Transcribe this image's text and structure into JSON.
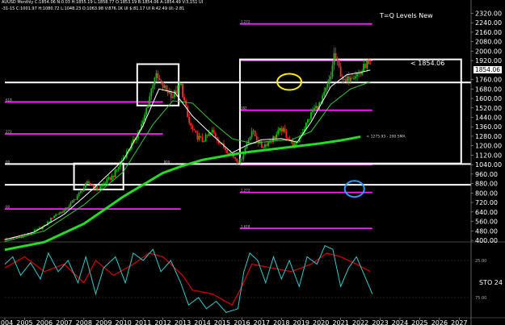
{
  "header": {
    "line1": "AUUSD Monthly C:1854.06 N:0.03 H:1855.19 L:1858.77 O:1853.19 B:1854.06 A:1854.49 V:3,151 UI",
    "line2": "-31-15 C:1001.97 H:1080.72 L:1048.23 O:1063.98 V:876.1K UI $:81.17 UI R:42.49 UI:-2.81"
  },
  "levels_title": "T=Q Levels New",
  "current_price_label": "< 1854.06",
  "price_tag": "1854.06",
  "sma_label": "< 1275.93 - 200 SMA",
  "sto_label": "STO 24",
  "colors": {
    "up": "#00c800",
    "down": "#ff2a2a",
    "sma_fast": "#ffffff",
    "sma_mid": "#33cc33",
    "sma_200": "#22dd22",
    "magenta": "#ff22ff",
    "red_line": "#cc0000",
    "cyan": "#33cccc",
    "yellow_circle": "#ffee00",
    "blue_circle": "#3399ff"
  },
  "chart_data": [
    {
      "type": "candlestick",
      "title": "AUUSD Monthly",
      "y_ticks": [
        400,
        480,
        560,
        640,
        720,
        800,
        880,
        960,
        1040,
        1120,
        1200,
        1280,
        1360,
        1440,
        1520,
        1600,
        1680,
        1760,
        1840,
        1920,
        2000,
        2080,
        2160,
        2240,
        2320
      ],
      "x_ticks": [
        "2004",
        "2005",
        "2006",
        "2007",
        "2008",
        "2009",
        "2010",
        "2011",
        "2012",
        "2013",
        "2014",
        "2015",
        "2016",
        "2017",
        "2018",
        "2019",
        "2020",
        "2021",
        "2022",
        "2023",
        "2024",
        "2025",
        "2026",
        "2027"
      ],
      "ylim": [
        400,
        2330
      ],
      "xlim": [
        2004.0,
        2027.6
      ],
      "grid": false,
      "close_anchors": [
        [
          2004.0,
          410
        ],
        [
          2005.0,
          435
        ],
        [
          2006.0,
          520
        ],
        [
          2006.5,
          610
        ],
        [
          2007.0,
          650
        ],
        [
          2007.6,
          760
        ],
        [
          2008.2,
          890
        ],
        [
          2008.7,
          830
        ],
        [
          2009.0,
          880
        ],
        [
          2009.5,
          950
        ],
        [
          2010.0,
          1100
        ],
        [
          2010.5,
          1230
        ],
        [
          2011.0,
          1400
        ],
        [
          2011.6,
          1800
        ],
        [
          2012.0,
          1700
        ],
        [
          2012.5,
          1620
        ],
        [
          2012.9,
          1720
        ],
        [
          2013.3,
          1400
        ],
        [
          2013.6,
          1300
        ],
        [
          2014.0,
          1240
        ],
        [
          2014.5,
          1320
        ],
        [
          2015.0,
          1200
        ],
        [
          2015.9,
          1060
        ],
        [
          2016.5,
          1330
        ],
        [
          2017.0,
          1190
        ],
        [
          2017.5,
          1250
        ],
        [
          2018.0,
          1340
        ],
        [
          2018.7,
          1190
        ],
        [
          2019.0,
          1300
        ],
        [
          2019.6,
          1500
        ],
        [
          2020.0,
          1560
        ],
        [
          2020.5,
          1780
        ],
        [
          2020.65,
          1980
        ],
        [
          2021.2,
          1720
        ],
        [
          2021.5,
          1800
        ],
        [
          2022.0,
          1810
        ],
        [
          2022.3,
          1900
        ],
        [
          2022.5,
          1854
        ]
      ],
      "series": [
        {
          "name": "200 SMA",
          "anchors": [
            [
              2004.0,
              320
            ],
            [
              2006.0,
              385
            ],
            [
              2008.0,
              540
            ],
            [
              2010.0,
              770
            ],
            [
              2012.0,
              970
            ],
            [
              2013.0,
              1030
            ],
            [
              2014.0,
              1080
            ],
            [
              2015.0,
              1110
            ],
            [
              2016.0,
              1140
            ],
            [
              2017.0,
              1160
            ],
            [
              2018.0,
              1180
            ],
            [
              2019.0,
              1200
            ],
            [
              2020.0,
              1220
            ],
            [
              2021.0,
              1245
            ],
            [
              2022.0,
              1276
            ]
          ],
          "value_label": 1275.93
        },
        {
          "name": "fast SMA",
          "anchors": [
            [
              2004.0,
              405
            ],
            [
              2005.5,
              470
            ],
            [
              2007.0,
              620
            ],
            [
              2008.5,
              840
            ],
            [
              2010.0,
              1080
            ],
            [
              2011.0,
              1370
            ],
            [
              2011.8,
              1680
            ],
            [
              2012.6,
              1650
            ],
            [
              2013.5,
              1450
            ],
            [
              2014.5,
              1290
            ],
            [
              2015.5,
              1140
            ],
            [
              2016.2,
              1200
            ],
            [
              2017.0,
              1250
            ],
            [
              2018.0,
              1260
            ],
            [
              2018.8,
              1230
            ],
            [
              2019.5,
              1400
            ],
            [
              2020.5,
              1700
            ],
            [
              2021.3,
              1800
            ],
            [
              2022.0,
              1820
            ],
            [
              2022.5,
              1840
            ]
          ]
        },
        {
          "name": "mid SMA",
          "anchors": [
            [
              2004.0,
              390
            ],
            [
              2006.0,
              480
            ],
            [
              2008.0,
              700
            ],
            [
              2010.0,
              980
            ],
            [
              2011.5,
              1380
            ],
            [
              2012.5,
              1580
            ],
            [
              2013.5,
              1560
            ],
            [
              2014.5,
              1400
            ],
            [
              2015.5,
              1260
            ],
            [
              2016.5,
              1220
            ],
            [
              2017.5,
              1240
            ],
            [
              2018.5,
              1250
            ],
            [
              2019.5,
              1320
            ],
            [
              2020.5,
              1550
            ],
            [
              2021.5,
              1680
            ],
            [
              2022.5,
              1740
            ]
          ]
        }
      ],
      "levels": [
        {
          "price": 1930,
          "label": "< 1854.06"
        },
        {
          "price": 1735
        },
        {
          "price": 1045
        },
        {
          "price": 870
        }
      ],
      "fib_levels": [
        {
          "label": "1.272",
          "price": 2230,
          "x_from": 2015.9,
          "x_to": 2022.6
        },
        {
          "label": "",
          "price": 1920,
          "x_from": 2015.9,
          "x_to": 2022.6
        },
        {
          "label": "618",
          "price": 1570,
          "x_from": 2004.0,
          "x_to": 2012.0
        },
        {
          "label": "382",
          "price": 1500,
          "x_from": 2015.9,
          "x_to": 2022.6
        },
        {
          "label": "272",
          "price": 1300,
          "x_from": 2004.0,
          "x_to": 2012.0
        },
        {
          "label": "00",
          "price": 1045,
          "x_from": 2004.0,
          "x_to": 2010.5
        },
        {
          "label": "800",
          "price": 1045,
          "x_from": 2012.0,
          "x_to": 2012.5
        },
        {
          "label": "",
          "price": 1040,
          "x_from": 2015.9,
          "x_to": 2022.6
        },
        {
          "label": "1.272",
          "price": 805,
          "x_from": 2015.9,
          "x_to": 2022.6
        },
        {
          "label": "00",
          "price": 665,
          "x_from": 2004.0,
          "x_to": 2012.9
        },
        {
          "label": "1.618",
          "price": 500,
          "x_from": 2015.9,
          "x_to": 2022.6
        }
      ],
      "boxes": [
        {
          "x0": 2007.5,
          "x1": 2010.0,
          "y0": 830,
          "y1": 1050
        },
        {
          "x0": 2010.7,
          "x1": 2012.8,
          "y0": 1540,
          "y1": 1890
        },
        {
          "x0": 2015.9,
          "x1": 2027.1,
          "y0": 1050,
          "y1": 1930
        }
      ]
    },
    {
      "type": "line",
      "title": "STO 24",
      "y_ticks": [
        25.0,
        75.0
      ],
      "ylim": [
        0,
        100
      ],
      "series": [
        {
          "name": "",
          "anchors": [
            [
              2004.0,
              35
            ],
            [
              2005.0,
              20
            ],
            [
              2006.0,
              40
            ],
            [
              2007.0,
              30
            ],
            [
              2008.0,
              55
            ],
            [
              2008.6,
              25
            ],
            [
              2009.5,
              45
            ],
            [
              2010.5,
              30
            ],
            [
              2011.3,
              15
            ],
            [
              2012.0,
              20
            ],
            [
              2013.0,
              45
            ],
            [
              2013.5,
              65
            ],
            [
              2014.5,
              70
            ],
            [
              2015.5,
              85
            ],
            [
              2016.0,
              60
            ],
            [
              2016.5,
              30
            ],
            [
              2017.5,
              35
            ],
            [
              2018.5,
              40
            ],
            [
              2019.5,
              30
            ],
            [
              2020.3,
              15
            ],
            [
              2021.0,
              20
            ],
            [
              2021.8,
              30
            ],
            [
              2022.5,
              40
            ]
          ]
        },
        {
          "name": "",
          "anchors": [
            [
              2004.0,
              30
            ],
            [
              2004.4,
              20
            ],
            [
              2004.8,
              45
            ],
            [
              2005.3,
              28
            ],
            [
              2005.8,
              50
            ],
            [
              2006.2,
              15
            ],
            [
              2006.7,
              40
            ],
            [
              2007.2,
              25
            ],
            [
              2007.7,
              55
            ],
            [
              2008.1,
              20
            ],
            [
              2008.6,
              70
            ],
            [
              2009.0,
              35
            ],
            [
              2009.6,
              20
            ],
            [
              2010.1,
              55
            ],
            [
              2010.5,
              15
            ],
            [
              2011.0,
              25
            ],
            [
              2011.5,
              10
            ],
            [
              2011.9,
              40
            ],
            [
              2012.4,
              25
            ],
            [
              2012.9,
              55
            ],
            [
              2013.3,
              85
            ],
            [
              2013.8,
              75
            ],
            [
              2014.2,
              90
            ],
            [
              2014.7,
              80
            ],
            [
              2015.2,
              95
            ],
            [
              2015.8,
              90
            ],
            [
              2016.1,
              40
            ],
            [
              2016.4,
              15
            ],
            [
              2016.8,
              25
            ],
            [
              2017.2,
              55
            ],
            [
              2017.6,
              20
            ],
            [
              2018.0,
              50
            ],
            [
              2018.4,
              25
            ],
            [
              2018.9,
              60
            ],
            [
              2019.3,
              20
            ],
            [
              2019.8,
              30
            ],
            [
              2020.2,
              5
            ],
            [
              2020.6,
              10
            ],
            [
              2021.0,
              60
            ],
            [
              2021.4,
              35
            ],
            [
              2021.8,
              20
            ],
            [
              2022.2,
              45
            ],
            [
              2022.6,
              70
            ]
          ]
        }
      ]
    }
  ]
}
